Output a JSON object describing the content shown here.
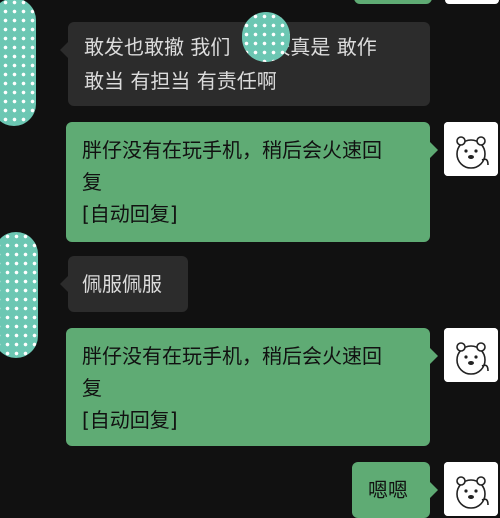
{
  "messages": [
    {
      "from": "other",
      "lines": [
        "敢发也敢撤 我们",
        "大校真是 敢作",
        "敢当 有担当 有责任啊"
      ]
    },
    {
      "from": "me",
      "lines": [
        "胖仔没有在玩手机，稍后会火速回",
        "复",
        "[自动回复]"
      ]
    },
    {
      "from": "other",
      "lines": [
        "佩服佩服"
      ]
    },
    {
      "from": "me",
      "lines": [
        "胖仔没有在玩手机，稍后会火速回",
        "复",
        "[自动回复]"
      ]
    },
    {
      "from": "me",
      "lines": [
        "嗯嗯"
      ]
    }
  ],
  "colors": {
    "background": "#111111",
    "incoming_bubble": "#2c2c2c",
    "outgoing_bubble": "#5fab74",
    "avatar_teal": "#6cc7b3"
  },
  "icons": {
    "my_avatar": "bear-avatar-icon",
    "other_avatar": "polka-dot-avatar-icon"
  }
}
